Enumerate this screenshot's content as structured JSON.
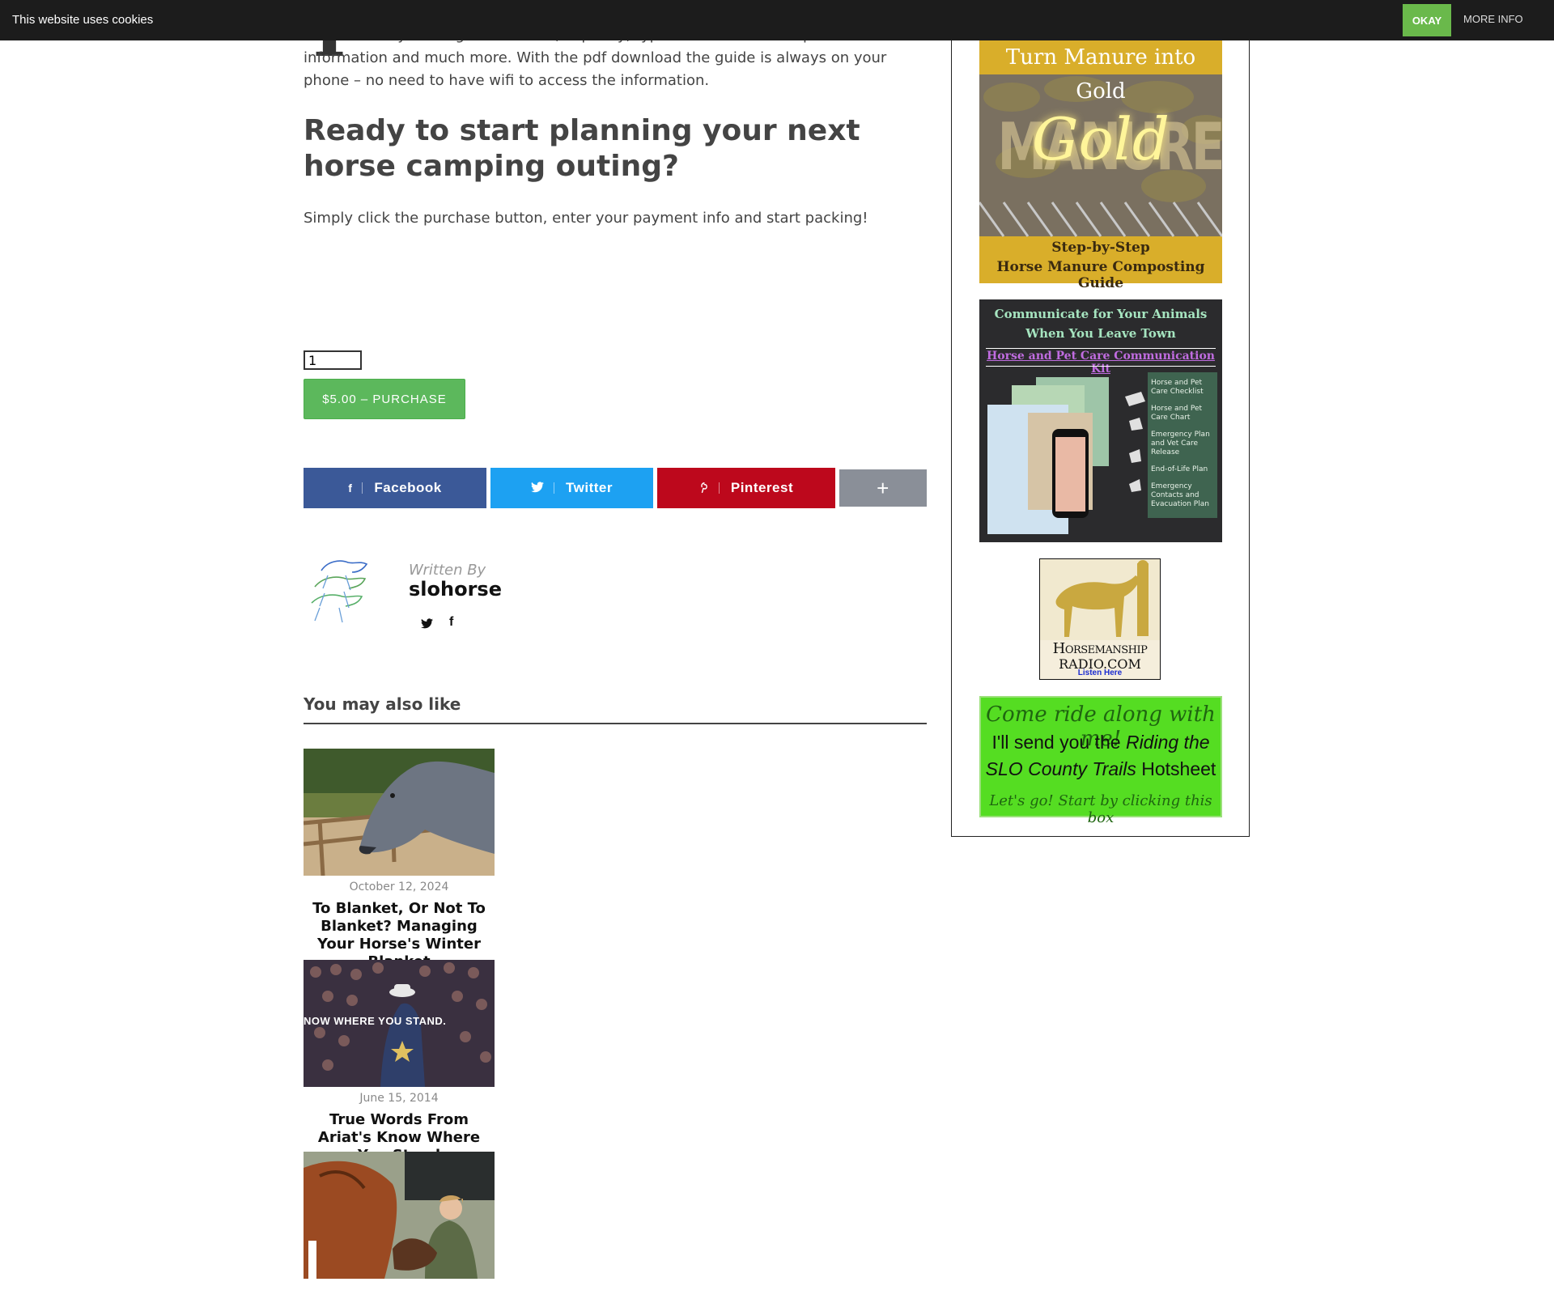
{
  "cookie": {
    "text": "This website uses cookies",
    "okay": "OKAY",
    "more": "MORE INFO"
  },
  "intro": {
    "dropcap": "T",
    "rest": "he e-book provides you the info you are looking for to enjoy horse camping in SLO County. You'll get directions, capacity, types of trails and camp amenities information and much more. With the pdf download the guide is always on your phone – no need to have wifi to access the information."
  },
  "heading": "Ready to start planning your next horse camping outing?",
  "subline": "Simply click the purchase button, enter your payment info and start packing!",
  "purchase": {
    "quantity": "1",
    "button": "$5.00 – PURCHASE"
  },
  "share": {
    "facebook": "Facebook",
    "twitter": "Twitter",
    "pinterest": "Pinterest",
    "more": "+"
  },
  "author": {
    "written_by": "Written By",
    "name": "slohorse"
  },
  "related": {
    "heading": "You may also like",
    "posts": [
      {
        "date": "October 12, 2024",
        "title": "To Blanket, Or Not To Blanket? Managing Your Horse's Winter Blanket"
      },
      {
        "date": "June 15, 2014",
        "title": "True Words From Ariat's Know Where You Stand",
        "image_text": "NOW WHERE YOU STAND."
      },
      {
        "date": "",
        "title": ""
      }
    ]
  },
  "sidebar": {
    "manure": {
      "top": "Turn Manure into Gold",
      "image_word": "MANURE",
      "neon": "Gold",
      "bottom1": "Step-by-Step",
      "bottom2": "Horse Manure Composting Guide"
    },
    "communicate": {
      "line1": "Communicate for Your Animals",
      "line2": "When You Leave Town",
      "kit": "Horse and Pet Care Communication Kit",
      "items": [
        "Horse and Pet Care Checklist",
        "Horse and Pet Care Chart",
        "Emergency Plan and Vet Care Release",
        "End-of-Life Plan",
        "Emergency Contacts and Evacuation Plan"
      ]
    },
    "radio": {
      "name1": "Horsemanship",
      "name2": "Radio.com",
      "listen": "Listen Here"
    },
    "ride": {
      "line1": "Come ride along with me!",
      "line2a": "I'll send you the ",
      "line2b": "Riding the",
      "line3a": "SLO County Trails",
      "line3b": " Hotsheet",
      "line4": "Let's go! Start by clicking this box"
    }
  },
  "colors": {
    "cookie_bar": "#1c1c1c",
    "okay_green": "#6ab94b",
    "purchase_green": "#5cb85c",
    "facebook": "#3b5998",
    "twitter": "#1da1f2",
    "pinterest": "#bd081c",
    "share_more": "#8a8f98",
    "ride_green": "#55dd22",
    "manure_gold": "#d9ae2a"
  }
}
